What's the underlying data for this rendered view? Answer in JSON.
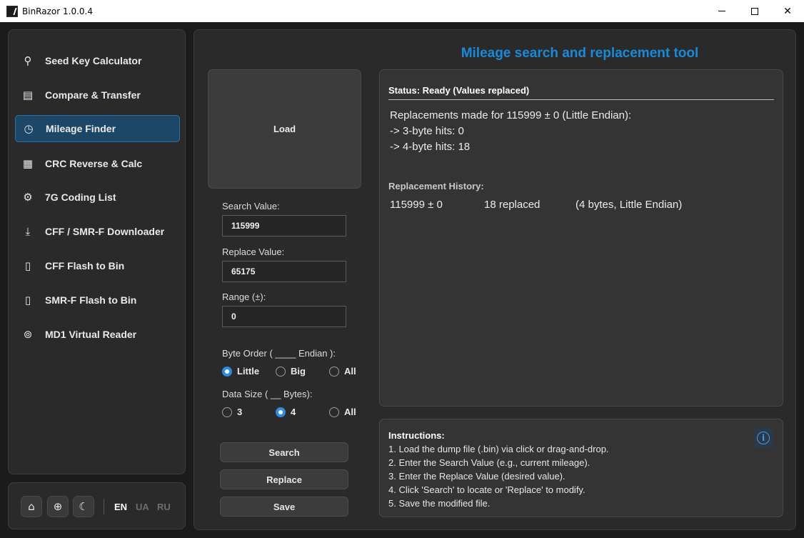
{
  "window": {
    "title": "BinRazor 1.0.0.4",
    "controls": {
      "minimize": "minimize",
      "maximize": "maximize",
      "close": "✕"
    }
  },
  "sidebar": {
    "items": [
      {
        "label": "Seed Key Calculator",
        "icon": "key-icon",
        "glyph": "⚲",
        "active": false
      },
      {
        "label": "Compare & Transfer",
        "icon": "compare-icon",
        "glyph": "▤",
        "active": false
      },
      {
        "label": "Mileage Finder",
        "icon": "clock-icon",
        "glyph": "◷",
        "active": true
      },
      {
        "label": "CRC Reverse & Calc",
        "icon": "calculator-icon",
        "glyph": "▦",
        "active": false
      },
      {
        "label": "7G Coding List",
        "icon": "gears-icon",
        "glyph": "⚙",
        "active": false
      },
      {
        "label": "CFF / SMR-F Downloader",
        "icon": "download-icon",
        "glyph": "⤓",
        "active": false
      },
      {
        "label": "CFF Flash to Bin",
        "icon": "file-chart-icon",
        "glyph": "▯",
        "active": false
      },
      {
        "label": "SMR-F Flash to Bin",
        "icon": "file-chart-icon",
        "glyph": "▯",
        "active": false
      },
      {
        "label": "MD1 Virtual Reader",
        "icon": "virtual-reader-icon",
        "glyph": "⊚",
        "active": false
      }
    ]
  },
  "bottom": {
    "home_icon": "⌂",
    "globe_icon": "⊕",
    "theme_icon": "☾",
    "languages": [
      {
        "code": "EN",
        "active": true
      },
      {
        "code": "UA",
        "active": false
      },
      {
        "code": "RU",
        "active": false
      }
    ]
  },
  "main": {
    "title": "Mileage search and replacement tool",
    "load_label": "Load",
    "search_value_label": "Search Value:",
    "search_value": "115999",
    "replace_value_label": "Replace Value:",
    "replace_value": "65175",
    "range_label": "Range (±):",
    "range_value": "0",
    "byte_order_label": "Byte Order ( ____ Endian ):",
    "byte_order_options": [
      {
        "label": "Little",
        "checked": true
      },
      {
        "label": "Big",
        "checked": false
      },
      {
        "label": "All",
        "checked": false
      }
    ],
    "data_size_label": "Data Size ( __ Bytes):",
    "data_size_options": [
      {
        "label": "3",
        "checked": false
      },
      {
        "label": "4",
        "checked": true
      },
      {
        "label": "All",
        "checked": false
      }
    ],
    "buttons": {
      "search": "Search",
      "replace": "Replace",
      "save": "Save"
    }
  },
  "status": {
    "title": "Status: Ready (Values replaced)",
    "lines": [
      "Replacements made for 115999 ± 0 (Little Endian):",
      "-> 3-byte hits: 0",
      "-> 4-byte hits: 18"
    ],
    "history_title": "Replacement History:",
    "history": [
      {
        "value": "115999 ± 0",
        "count": "18 replaced",
        "details": "(4 bytes, Little Endian)"
      }
    ]
  },
  "instructions": {
    "title": "Instructions:",
    "info_glyph": "i",
    "lines": [
      "1. Load the dump file (.bin) via click or drag-and-drop.",
      "2. Enter the Search Value (e.g., current mileage).",
      "3. Enter the Replace Value (desired value).",
      "4. Click 'Search' to locate or 'Replace' to modify.",
      "5. Save the modified file."
    ]
  },
  "colors": {
    "accent": "#1a8ad8",
    "active_nav": "#1c4766",
    "radio_checked": "#2d8de0"
  }
}
